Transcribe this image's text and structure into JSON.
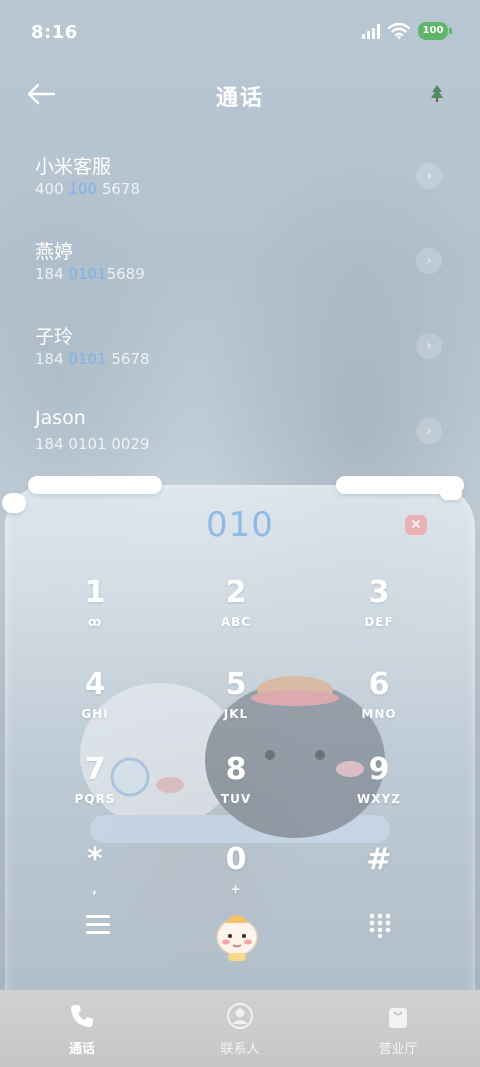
{
  "status": {
    "time": "8:16",
    "battery": "100"
  },
  "header": {
    "title": "通话"
  },
  "recents": [
    {
      "name": "小米客服",
      "number_pre": "400 ",
      "number_hl": "100",
      "number_post": " 5678"
    },
    {
      "name": "燕婷",
      "number_pre": "184 ",
      "number_hl": "0101",
      "number_post": "5689"
    },
    {
      "name": "子玲",
      "number_pre": "184 ",
      "number_hl": "0101",
      "number_post": " 5678"
    },
    {
      "name": "Jason",
      "number_pre": "184 0101 0029",
      "number_hl": "",
      "number_post": ""
    }
  ],
  "dialer": {
    "input": "010",
    "keys": [
      {
        "digit": "1",
        "letters": "ꝏ"
      },
      {
        "digit": "2",
        "letters": "ABC"
      },
      {
        "digit": "3",
        "letters": "DEF"
      },
      {
        "digit": "4",
        "letters": "GHI"
      },
      {
        "digit": "5",
        "letters": "JKL"
      },
      {
        "digit": "6",
        "letters": "MNO"
      },
      {
        "digit": "7",
        "letters": "PQRS"
      },
      {
        "digit": "8",
        "letters": "TUV"
      },
      {
        "digit": "9",
        "letters": "WXYZ"
      },
      {
        "digit": "*",
        "letters": ","
      },
      {
        "digit": "0",
        "letters": "+"
      },
      {
        "digit": "#",
        "letters": ""
      }
    ]
  },
  "bottom_nav": [
    {
      "label": "通话",
      "icon": "phone-icon",
      "active": true
    },
    {
      "label": "联系人",
      "icon": "person-icon",
      "active": false
    },
    {
      "label": "营业厅",
      "icon": "bag-icon",
      "active": false
    }
  ],
  "colors": {
    "accent": "#8fb9e6",
    "highlight": "#7fb2ec",
    "battery": "#5fb56a",
    "delete": "#e9b3b6"
  }
}
